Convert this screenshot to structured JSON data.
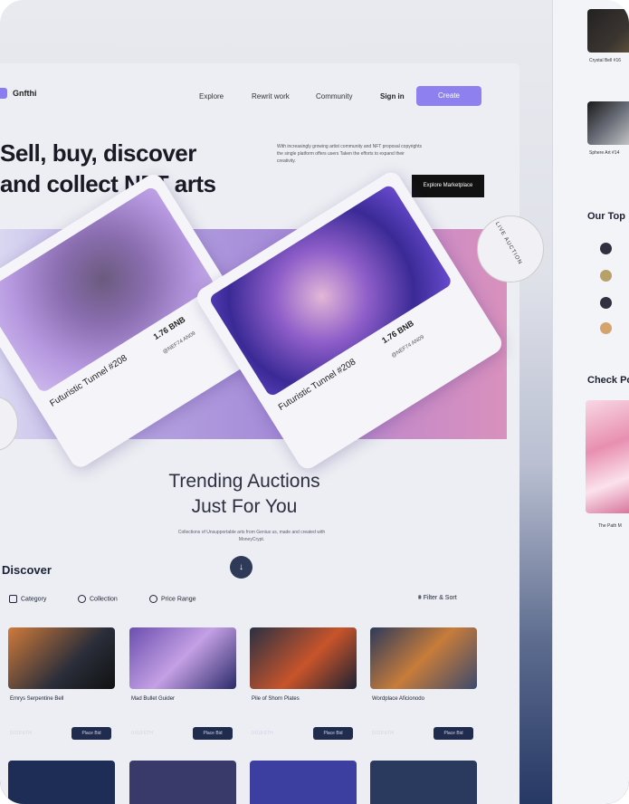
{
  "colors": {
    "accent": "#8e80ef",
    "dark": "#111111",
    "navy": "#1f2c4e"
  },
  "nav": {
    "brand": "Gnfthi",
    "links": [
      "Explore",
      "Rewrit work",
      "Community"
    ],
    "signin": "Sign in",
    "create": "Create"
  },
  "hero": {
    "title_line1": "Sell, buy, discover",
    "title_line2": "and collect NFT arts",
    "subtitle": "With increasingly growing artist community and NFT proposal copyrights the single platform offers users Taken the efforts to expand their creativity.",
    "explore_button": "Explore Marketplace"
  },
  "cards": [
    {
      "title": "Futuristic Tunnel #208",
      "price": "1.76 BNB",
      "owner": "@NEF74 AN09"
    },
    {
      "title": "Futuristic Tunnel #208",
      "price": "1.76 BNB",
      "owner": "@NEF74 AN09"
    }
  ],
  "badge_text": "LIVE AUCTION",
  "trending": {
    "title_line1": "Trending Auctions",
    "title_line2": "Just For You",
    "subtitle": "Collections of Unsupportable arts from Genius us, made and created with MoneyCrypt."
  },
  "discover": {
    "title": "Discover",
    "filters": [
      "Category",
      "Collection",
      "Price Range"
    ],
    "sort": "Filter & Sort",
    "items": [
      {
        "name": "Emrys Serpentine Bell",
        "price": "0.019 ETH",
        "bid": "Place Bid"
      },
      {
        "name": "Mad Bullet Guider",
        "price": "0.019 ETH",
        "bid": "Place Bid"
      },
      {
        "name": "Pile of Shorn Plates",
        "price": "0.019 ETH",
        "bid": "Place Bid"
      },
      {
        "name": "Wordplace Aficionodo",
        "price": "0.019 ETH",
        "bid": "Place Bid"
      }
    ]
  },
  "side_panel": {
    "item1": "Crystal Bell #16",
    "item2": "Sphere Art #14",
    "heading1": "Our Top",
    "heading2": "Check Po",
    "footer": "The Path M"
  }
}
